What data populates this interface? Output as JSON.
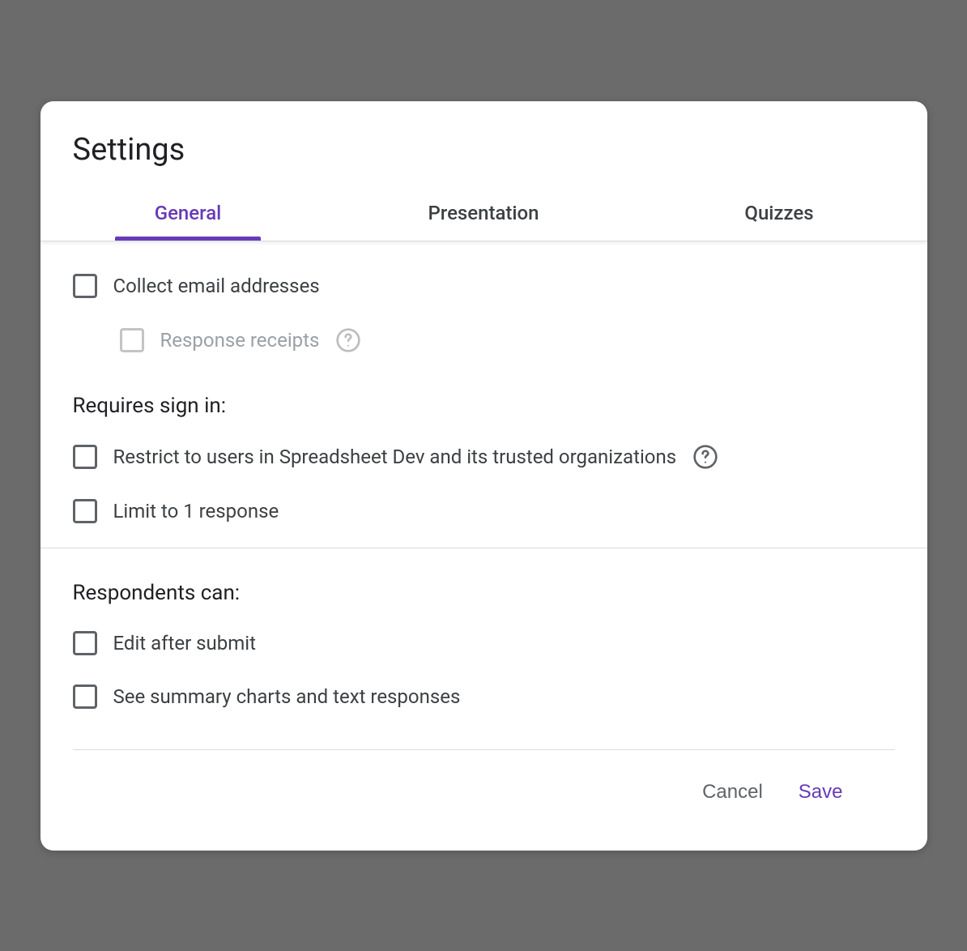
{
  "dialog": {
    "title": "Settings"
  },
  "tabs": [
    {
      "label": "General",
      "active": true
    },
    {
      "label": "Presentation",
      "active": false
    },
    {
      "label": "Quizzes",
      "active": false
    }
  ],
  "sections": {
    "top": {
      "collect_email": "Collect email addresses",
      "response_receipts": "Response receipts"
    },
    "signin": {
      "heading": "Requires sign in:",
      "restrict": "Restrict to users in Spreadsheet Dev and its trusted organizations",
      "limit": "Limit to 1 response"
    },
    "respondents": {
      "heading": "Respondents can:",
      "edit": "Edit after submit",
      "summary": "See summary charts and text responses"
    }
  },
  "actions": {
    "cancel": "Cancel",
    "save": "Save"
  }
}
